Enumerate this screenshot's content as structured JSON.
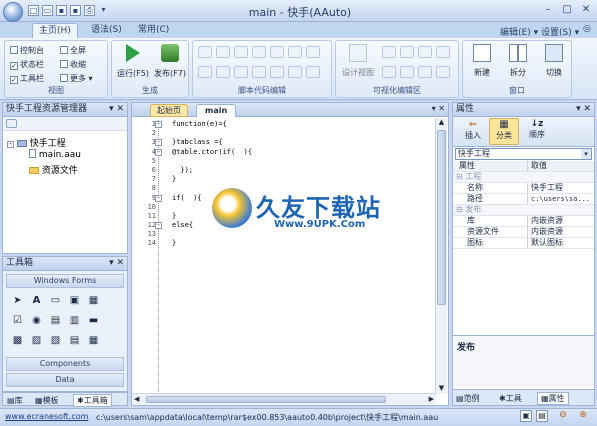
{
  "window": {
    "title": "main - 快手(AAuto)"
  },
  "quick_access": {
    "icons": [
      "new-file-icon",
      "open-folder-icon",
      "save-icon",
      "save-all-icon",
      "print-icon"
    ]
  },
  "menu_tabs": [
    "主页(H)",
    "语法(S)",
    "常用(C)"
  ],
  "top_links": {
    "edit": "编辑(E) ▾",
    "settings": "设置(S) ▾"
  },
  "ribbon": {
    "view_group": {
      "label": "视图",
      "items": [
        {
          "label": "控制台",
          "checked": false
        },
        {
          "label": "全屏",
          "checked": false
        },
        {
          "label": "状态栏",
          "checked": true
        },
        {
          "label": "收缩",
          "checked": false
        },
        {
          "label": "工具栏",
          "checked": true
        },
        {
          "label": "更多 ▾",
          "checked": false
        }
      ]
    },
    "build_group": {
      "label": "生成",
      "run": "运行(F5)",
      "publish": "发布(F7)"
    },
    "script_edit_group": {
      "label": "脚本代码编辑"
    },
    "visual_group": {
      "label": "可视化编辑区",
      "design_view": "设计视图"
    },
    "window_group": {
      "label": "窗口",
      "new": "新建",
      "split": "拆分",
      "switch": "切换"
    }
  },
  "project_panel": {
    "title": "快手工程资源管理器",
    "tree": [
      {
        "label": "快手工程",
        "level": 0,
        "expand": "-"
      },
      {
        "label": "main.aau",
        "level": 1
      },
      {
        "label": "资源文件",
        "level": 1
      }
    ]
  },
  "toolbox": {
    "title": "工具箱",
    "section": "Windows Forms",
    "components": "Components",
    "data": "Data"
  },
  "left_bottom_tabs": [
    "库",
    "模板",
    "工具箱"
  ],
  "editor": {
    "tabs": [
      "起始页",
      "main"
    ],
    "line_numbers": [
      "1",
      "2",
      "3",
      "4",
      "5",
      "6",
      "7",
      "8",
      "9",
      "10",
      "11",
      "12",
      "13",
      "14"
    ],
    "lines": [
      "function(e)={",
      "",
      "}tabclass ={",
      "@table.ctor(if(  ){",
      "",
      "  });",
      "}",
      "",
      "if(  ){",
      "",
      "}",
      "else{",
      "",
      "}"
    ]
  },
  "watermark": {
    "name": "久友下载站",
    "url": "Www.9UPK.Com"
  },
  "properties": {
    "title": "属性",
    "tabs": [
      "插入",
      "分类",
      "顺序"
    ],
    "object": "快手工程",
    "headers": [
      "属性",
      "取值"
    ],
    "groups": [
      {
        "name": "工程",
        "rows": [
          [
            "名称",
            "快手工程"
          ],
          [
            "路径",
            "c:\\users\\sa..."
          ]
        ]
      },
      {
        "name": "发布",
        "rows": [
          [
            "库",
            "内嵌资源"
          ],
          [
            "资源文件",
            "内嵌资源"
          ],
          [
            "图标",
            "默认图标"
          ]
        ]
      }
    ],
    "description": "发布"
  },
  "right_bottom_tabs": [
    "范例",
    "工具",
    "属性"
  ],
  "status": {
    "link": "www.ecranesoft.com",
    "path": "c:\\users\\sam\\appdata\\local\\temp\\rar$ex00.853\\aauto0.40b\\project\\快手工程\\main.aau"
  },
  "colors": {
    "accent": "#4a73b5",
    "watermark_text": "#1e64b4"
  }
}
